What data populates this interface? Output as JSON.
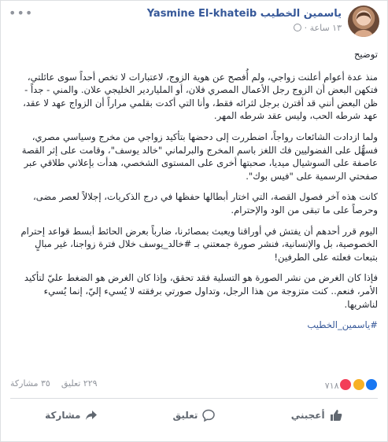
{
  "author": {
    "name": "ياسمين الخطيب Yasmine El-khateib",
    "time": "١٣ ساعة ·"
  },
  "post": {
    "title": "توضيح",
    "paragraphs": [
      "منذ عدة أعوام أعلنت زواجي، ولم أُفصح عن هوية الزوج، لاعتبارات لا تخص أحداً سوى عائلتي، فتكهن البعض أن الزوج رجل الأعمال المصري فلان، أو الملياردير الخليجي علان. والمني - جداً - ظن البعض أنني قد أقترن برجل لثرائه فقط، وأنا التي أكدت بقلمي مراراً أن الزواج عهد لا عقد، عهد شرطه الحب، وليس عقد شرطه المهر.",
      "ولما ازدادت الشائعات رواجاً، اضطررت إلى دحضها بتأكيد زواجي من مخرج وسياسي مصري، فسهُّل على الفضوليين فك اللغز باسم المخرج والبرلماني \"خالد يوسف\"، وقامت على إثر القصة عاصفة على السوشيال ميديا، صحبتها أخرى على المستوى الشخصي، هدأت بإعلاني طلاقي عبر صفحتي الرسمية على \"فيس بوك\".",
      "كانت هذه آخر فصول القصة، التي اختار أبطالها حفظها في درج الذكريات، إجلالاً لعصر مضى، وحرصاً على ما تبقى من الود والإحترام.",
      "اليوم قرر أحدهم أن يفتش في أوراقنا ويعبث بمصائرنا، ضارباً بعرض الحائط أبسط قواعد إحترام الخصوصية، بل والإنسانية، فنشر صورة جمعتني بـ #خالد_يوسف خلال فترة زواجنا، غير مبالٍ بتبعات فعلته على الطرفين!",
      "فإذا كان الغرض من نشر الصورة هو التسلية فقد تحقق، وإذا كان الغرض هو الضغط عليّ لتأكيد الأمر، فنعم.. كنت متزوجة من هذا الرجل، وتداول صورتي برفقته لا يُسيء إليّ، إنما يُسيء لناشريها."
    ],
    "hashtag": "#ياسمين_الخطيب"
  },
  "stats": {
    "reactions_count": "٧١٨",
    "comments": "٢٢٩ تعليق",
    "shares": "٣٥ مشاركة"
  },
  "actions": {
    "like": "أعجبني",
    "comment": "تعليق",
    "share": "مشاركة"
  },
  "colors": {
    "link": "#365899",
    "meta": "#90949c",
    "like_blue": "#1877f2"
  }
}
